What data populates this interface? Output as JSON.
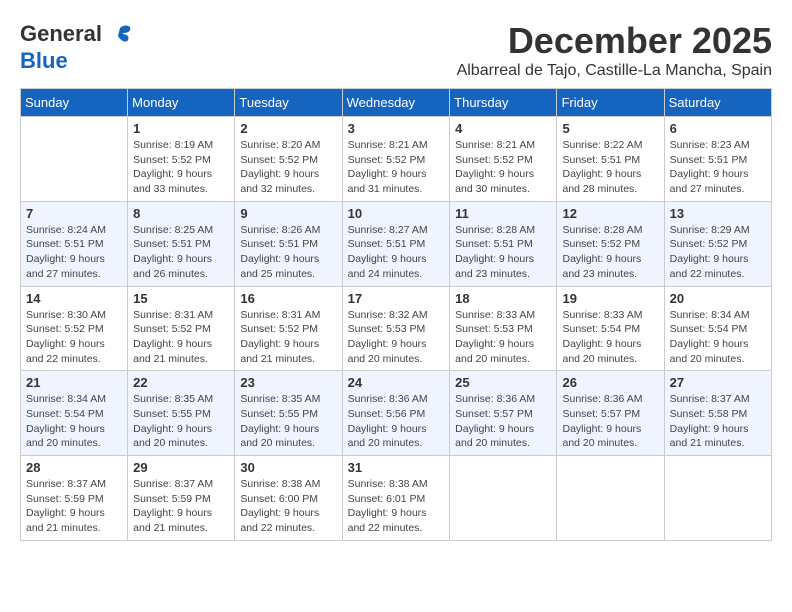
{
  "logo": {
    "general": "General",
    "blue": "Blue"
  },
  "title": "December 2025",
  "location": "Albarreal de Tajo, Castille-La Mancha, Spain",
  "days_of_week": [
    "Sunday",
    "Monday",
    "Tuesday",
    "Wednesday",
    "Thursday",
    "Friday",
    "Saturday"
  ],
  "weeks": [
    [
      {
        "day": "",
        "info": ""
      },
      {
        "day": "1",
        "info": "Sunrise: 8:19 AM\nSunset: 5:52 PM\nDaylight: 9 hours\nand 33 minutes."
      },
      {
        "day": "2",
        "info": "Sunrise: 8:20 AM\nSunset: 5:52 PM\nDaylight: 9 hours\nand 32 minutes."
      },
      {
        "day": "3",
        "info": "Sunrise: 8:21 AM\nSunset: 5:52 PM\nDaylight: 9 hours\nand 31 minutes."
      },
      {
        "day": "4",
        "info": "Sunrise: 8:21 AM\nSunset: 5:52 PM\nDaylight: 9 hours\nand 30 minutes."
      },
      {
        "day": "5",
        "info": "Sunrise: 8:22 AM\nSunset: 5:51 PM\nDaylight: 9 hours\nand 28 minutes."
      },
      {
        "day": "6",
        "info": "Sunrise: 8:23 AM\nSunset: 5:51 PM\nDaylight: 9 hours\nand 27 minutes."
      }
    ],
    [
      {
        "day": "7",
        "info": "Sunrise: 8:24 AM\nSunset: 5:51 PM\nDaylight: 9 hours\nand 27 minutes."
      },
      {
        "day": "8",
        "info": "Sunrise: 8:25 AM\nSunset: 5:51 PM\nDaylight: 9 hours\nand 26 minutes."
      },
      {
        "day": "9",
        "info": "Sunrise: 8:26 AM\nSunset: 5:51 PM\nDaylight: 9 hours\nand 25 minutes."
      },
      {
        "day": "10",
        "info": "Sunrise: 8:27 AM\nSunset: 5:51 PM\nDaylight: 9 hours\nand 24 minutes."
      },
      {
        "day": "11",
        "info": "Sunrise: 8:28 AM\nSunset: 5:51 PM\nDaylight: 9 hours\nand 23 minutes."
      },
      {
        "day": "12",
        "info": "Sunrise: 8:28 AM\nSunset: 5:52 PM\nDaylight: 9 hours\nand 23 minutes."
      },
      {
        "day": "13",
        "info": "Sunrise: 8:29 AM\nSunset: 5:52 PM\nDaylight: 9 hours\nand 22 minutes."
      }
    ],
    [
      {
        "day": "14",
        "info": "Sunrise: 8:30 AM\nSunset: 5:52 PM\nDaylight: 9 hours\nand 22 minutes."
      },
      {
        "day": "15",
        "info": "Sunrise: 8:31 AM\nSunset: 5:52 PM\nDaylight: 9 hours\nand 21 minutes."
      },
      {
        "day": "16",
        "info": "Sunrise: 8:31 AM\nSunset: 5:52 PM\nDaylight: 9 hours\nand 21 minutes."
      },
      {
        "day": "17",
        "info": "Sunrise: 8:32 AM\nSunset: 5:53 PM\nDaylight: 9 hours\nand 20 minutes."
      },
      {
        "day": "18",
        "info": "Sunrise: 8:33 AM\nSunset: 5:53 PM\nDaylight: 9 hours\nand 20 minutes."
      },
      {
        "day": "19",
        "info": "Sunrise: 8:33 AM\nSunset: 5:54 PM\nDaylight: 9 hours\nand 20 minutes."
      },
      {
        "day": "20",
        "info": "Sunrise: 8:34 AM\nSunset: 5:54 PM\nDaylight: 9 hours\nand 20 minutes."
      }
    ],
    [
      {
        "day": "21",
        "info": "Sunrise: 8:34 AM\nSunset: 5:54 PM\nDaylight: 9 hours\nand 20 minutes."
      },
      {
        "day": "22",
        "info": "Sunrise: 8:35 AM\nSunset: 5:55 PM\nDaylight: 9 hours\nand 20 minutes."
      },
      {
        "day": "23",
        "info": "Sunrise: 8:35 AM\nSunset: 5:55 PM\nDaylight: 9 hours\nand 20 minutes."
      },
      {
        "day": "24",
        "info": "Sunrise: 8:36 AM\nSunset: 5:56 PM\nDaylight: 9 hours\nand 20 minutes."
      },
      {
        "day": "25",
        "info": "Sunrise: 8:36 AM\nSunset: 5:57 PM\nDaylight: 9 hours\nand 20 minutes."
      },
      {
        "day": "26",
        "info": "Sunrise: 8:36 AM\nSunset: 5:57 PM\nDaylight: 9 hours\nand 20 minutes."
      },
      {
        "day": "27",
        "info": "Sunrise: 8:37 AM\nSunset: 5:58 PM\nDaylight: 9 hours\nand 21 minutes."
      }
    ],
    [
      {
        "day": "28",
        "info": "Sunrise: 8:37 AM\nSunset: 5:59 PM\nDaylight: 9 hours\nand 21 minutes."
      },
      {
        "day": "29",
        "info": "Sunrise: 8:37 AM\nSunset: 5:59 PM\nDaylight: 9 hours\nand 21 minutes."
      },
      {
        "day": "30",
        "info": "Sunrise: 8:38 AM\nSunset: 6:00 PM\nDaylight: 9 hours\nand 22 minutes."
      },
      {
        "day": "31",
        "info": "Sunrise: 8:38 AM\nSunset: 6:01 PM\nDaylight: 9 hours\nand 22 minutes."
      },
      {
        "day": "",
        "info": ""
      },
      {
        "day": "",
        "info": ""
      },
      {
        "day": "",
        "info": ""
      }
    ]
  ]
}
